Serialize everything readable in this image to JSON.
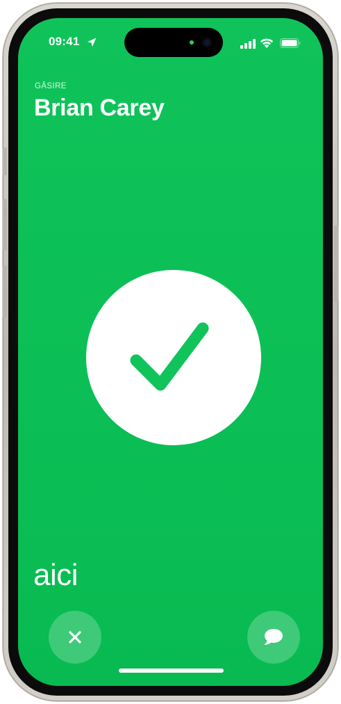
{
  "status_bar": {
    "time": "09:41"
  },
  "header": {
    "caption": "GĂSIRE",
    "title": "Brian Carey"
  },
  "indicator": {
    "word": "aici"
  },
  "icons": {
    "location": "location-arrow-icon",
    "signal": "cellular-signal-icon",
    "wifi": "wifi-icon",
    "battery": "battery-icon",
    "check": "checkmark-icon",
    "cancel": "close-icon",
    "message": "message-bubble-icon"
  },
  "colors": {
    "screen_background": "#0bbf56",
    "check_stroke": "#10c35a",
    "button_fill": "rgba(255,255,255,0.22)"
  }
}
